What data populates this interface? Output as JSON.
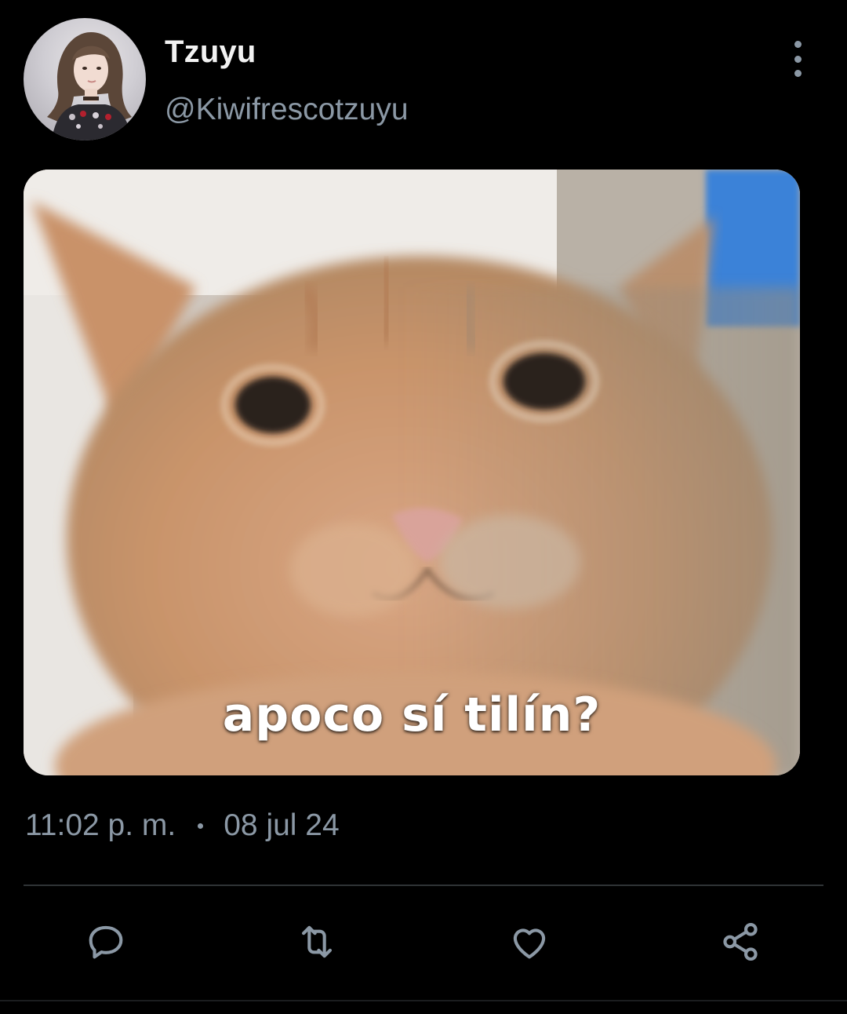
{
  "author": {
    "display_name": "Tzuyu",
    "handle": "@Kiwifrescotzuyu"
  },
  "media": {
    "caption": "apoco sí tilín?"
  },
  "meta": {
    "time": "11:02 p. m.",
    "separator": "·",
    "date": "08 jul 24"
  },
  "actions": [
    {
      "icon": "reply-icon"
    },
    {
      "icon": "retweet-icon"
    },
    {
      "icon": "like-icon"
    },
    {
      "icon": "share-icon"
    }
  ],
  "colors": {
    "background": "#000000",
    "primary_text": "#e7e9ea",
    "secondary_text": "#8b98a5",
    "divider": "#2f3336"
  }
}
